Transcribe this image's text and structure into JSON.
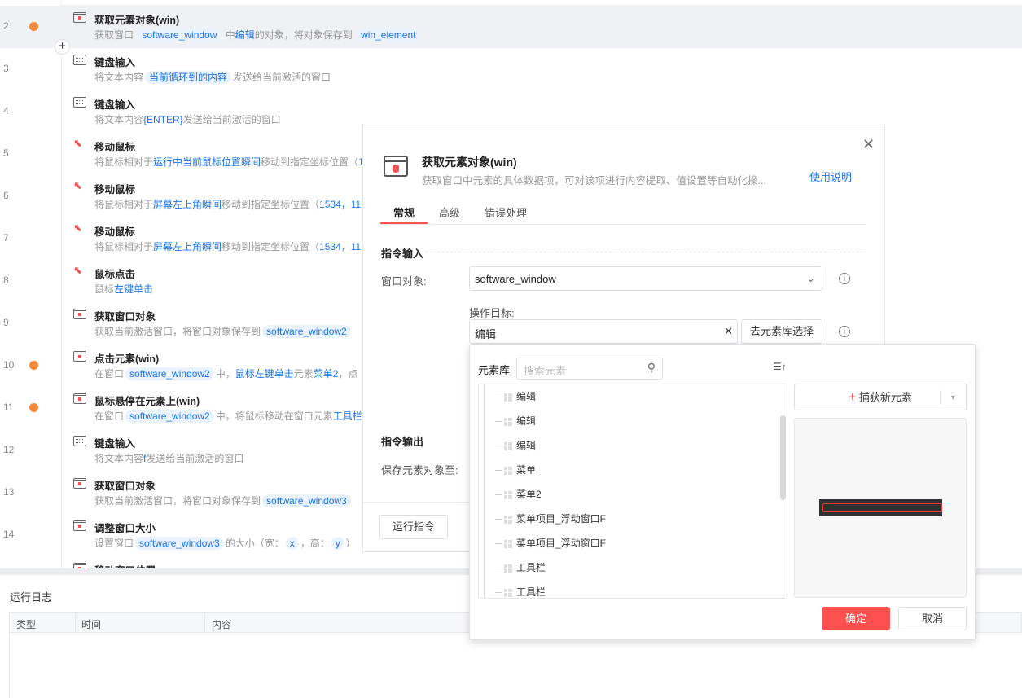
{
  "flow": {
    "rows": [
      {
        "num": "2",
        "breakpoint": true,
        "icon": "win",
        "title": "获取元素对象(win)",
        "desc": [
          {
            "t": "获取窗口 ",
            "k": "text"
          },
          {
            "t": "software_window",
            "k": "chip"
          },
          {
            "t": " 中",
            "k": "text"
          },
          {
            "t": "编辑",
            "k": "link"
          },
          {
            "t": "的对象，将对象保存到 ",
            "k": "text"
          },
          {
            "t": "win_element",
            "k": "chip"
          }
        ]
      },
      {
        "num": "3",
        "breakpoint": false,
        "icon": "kb",
        "title": "键盘输入",
        "desc": [
          {
            "t": "将文本内容",
            "k": "text"
          },
          {
            "t": "当前循环到的内容",
            "k": "chip"
          },
          {
            "t": "发送给当前激活的窗口",
            "k": "text"
          }
        ]
      },
      {
        "num": "4",
        "breakpoint": false,
        "icon": "kb",
        "title": "键盘输入",
        "desc": [
          {
            "t": "将文本内容",
            "k": "text"
          },
          {
            "t": "{ENTER}",
            "k": "link"
          },
          {
            "t": "发送给当前激活的窗口",
            "k": "text"
          }
        ]
      },
      {
        "num": "5",
        "breakpoint": false,
        "icon": "cur",
        "title": "移动鼠标",
        "desc": [
          {
            "t": "将鼠标相对于",
            "k": "text"
          },
          {
            "t": "运行中当前鼠标位置瞬间",
            "k": "link"
          },
          {
            "t": "移动到指定坐标位置（",
            "k": "text"
          },
          {
            "t": "1",
            "k": "link"
          }
        ]
      },
      {
        "num": "6",
        "breakpoint": false,
        "icon": "cur",
        "title": "移动鼠标",
        "desc": [
          {
            "t": "将鼠标相对于",
            "k": "text"
          },
          {
            "t": "屏幕左上角瞬间",
            "k": "link"
          },
          {
            "t": "移动到指定坐标位置（",
            "k": "text"
          },
          {
            "t": "1534，11",
            "k": "link"
          }
        ]
      },
      {
        "num": "7",
        "breakpoint": false,
        "icon": "cur",
        "title": "移动鼠标",
        "desc": [
          {
            "t": "将鼠标相对于",
            "k": "text"
          },
          {
            "t": "屏幕左上角瞬间",
            "k": "link"
          },
          {
            "t": "移动到指定坐标位置（",
            "k": "text"
          },
          {
            "t": "1534，11",
            "k": "link"
          }
        ]
      },
      {
        "num": "8",
        "breakpoint": false,
        "icon": "cur",
        "title": "鼠标点击",
        "desc": [
          {
            "t": "鼠标",
            "k": "text"
          },
          {
            "t": "左键单击",
            "k": "link"
          }
        ]
      },
      {
        "num": "9",
        "breakpoint": false,
        "icon": "win",
        "title": "获取窗口对象",
        "desc": [
          {
            "t": "获取当前激活窗口，将窗口对象保存到",
            "k": "text"
          },
          {
            "t": "software_window2",
            "k": "chip"
          }
        ]
      },
      {
        "num": "10",
        "breakpoint": true,
        "icon": "win",
        "title": "点击元素(win)",
        "desc": [
          {
            "t": "在窗口",
            "k": "text"
          },
          {
            "t": "software_window2",
            "k": "chip"
          },
          {
            "t": "中，",
            "k": "text"
          },
          {
            "t": "鼠标左键单击",
            "k": "link"
          },
          {
            "t": "元素",
            "k": "text"
          },
          {
            "t": "菜单2",
            "k": "link"
          },
          {
            "t": "，点",
            "k": "text"
          }
        ]
      },
      {
        "num": "11",
        "breakpoint": true,
        "icon": "win",
        "title": "鼠标悬停在元素上(win)",
        "desc": [
          {
            "t": "在窗口",
            "k": "text"
          },
          {
            "t": "software_window2",
            "k": "chip"
          },
          {
            "t": "中，将鼠标移动在窗口元素",
            "k": "text"
          },
          {
            "t": "工具栏",
            "k": "link"
          }
        ]
      },
      {
        "num": "12",
        "breakpoint": false,
        "icon": "kb",
        "title": "键盘输入",
        "desc": [
          {
            "t": "将文本内容",
            "k": "text"
          },
          {
            "t": "f",
            "k": "link"
          },
          {
            "t": "发送给当前激活的窗口",
            "k": "text"
          }
        ]
      },
      {
        "num": "13",
        "breakpoint": false,
        "icon": "win",
        "title": "获取窗口对象",
        "desc": [
          {
            "t": "获取当前激活窗口，将窗口对象保存到",
            "k": "text"
          },
          {
            "t": "software_window3",
            "k": "chip"
          }
        ]
      },
      {
        "num": "14",
        "breakpoint": false,
        "icon": "win",
        "title": "调整窗口大小",
        "desc": [
          {
            "t": "设置窗口",
            "k": "text"
          },
          {
            "t": "software_window3",
            "k": "chip"
          },
          {
            "t": "的大小（宽：",
            "k": "text"
          },
          {
            "t": "x",
            "k": "chip"
          },
          {
            "t": "，高：",
            "k": "text"
          },
          {
            "t": "y",
            "k": "chip"
          },
          {
            "t": "）",
            "k": "text"
          }
        ]
      },
      {
        "num": "",
        "breakpoint": false,
        "icon": "win",
        "title": "移动窗口位置",
        "desc": []
      }
    ]
  },
  "log": {
    "title": "运行日志",
    "columns": [
      "类型",
      "时间",
      "内容"
    ]
  },
  "modal": {
    "title": "获取元素对象(win)",
    "description": "获取窗口中元素的具体数据项，可对该项进行内容提取、值设置等自动化操...",
    "help_link": "使用说明",
    "tabs": [
      "常规",
      "高级",
      "错误处理"
    ],
    "input_section": "指令输入",
    "window_label": "窗口对象:",
    "window_value": "software_window",
    "target_label": "操作目标:",
    "target_value": "编辑",
    "pick_button": "去元素库选择",
    "output_section": "指令输出",
    "save_label": "保存元素对象至:",
    "run_button": "运行指令"
  },
  "library": {
    "label": "元素库",
    "search_placeholder": "搜索元素",
    "items": [
      "编辑",
      "编辑",
      "编辑",
      "菜单",
      "菜单2",
      "菜单项目_浮动窗口F",
      "菜单项目_浮动窗口F",
      "工具栏",
      "工具栏"
    ],
    "capture_button": "捕获新元素",
    "confirm": "确定",
    "cancel": "取消"
  },
  "colors": {
    "accent": "#ff5050",
    "link": "#1a73e8",
    "breakpoint": "#f5883a"
  }
}
